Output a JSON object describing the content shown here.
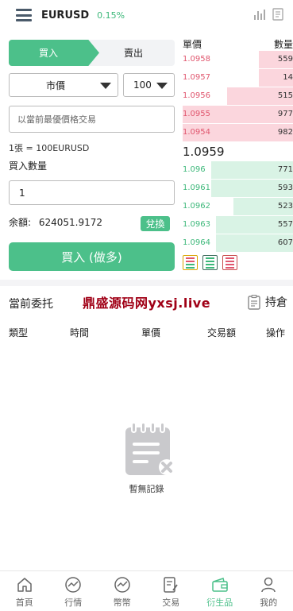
{
  "header": {
    "symbol": "EURUSD",
    "change": "0.15%"
  },
  "trade": {
    "buy_tab": "買入",
    "sell_tab": "賣出",
    "order_type": "市價",
    "amount": "100",
    "price_placeholder": "以當前最優價格交易",
    "lot_info": "1張 = 100EURUSD",
    "qty_label": "買入數量",
    "qty_value": "1",
    "balance_label": "余額:",
    "balance_value": "624051.9172",
    "exchange_label": "兌換",
    "buy_button": "買入 (做多)"
  },
  "orderbook": {
    "price_header": "單價",
    "qty_header": "數量",
    "asks": [
      {
        "price": "1.0958",
        "qty": "559",
        "depth": 0.31
      },
      {
        "price": "1.0957",
        "qty": "14",
        "depth": 0.31
      },
      {
        "price": "1.0956",
        "qty": "515",
        "depth": 0.6
      },
      {
        "price": "1.0955",
        "qty": "977",
        "depth": 1.0
      },
      {
        "price": "1.0954",
        "qty": "982",
        "depth": 1.0
      }
    ],
    "mid_price": "1.0959",
    "bids": [
      {
        "price": "1.096",
        "qty": "771",
        "depth": 0.74
      },
      {
        "price": "1.0961",
        "qty": "593",
        "depth": 0.74
      },
      {
        "price": "1.0962",
        "qty": "523",
        "depth": 0.54
      },
      {
        "price": "1.0963",
        "qty": "557",
        "depth": 0.7
      },
      {
        "price": "1.0964",
        "qty": "607",
        "depth": 0.7
      }
    ]
  },
  "orders": {
    "title": "當前委托",
    "watermark": "鼎盛源码网yxsj.live",
    "hold_label": "持倉",
    "columns": [
      "類型",
      "時間",
      "單價",
      "交易額",
      "操作"
    ],
    "empty_text": "暫無記錄"
  },
  "nav": [
    {
      "label": "首頁",
      "icon": "home-icon"
    },
    {
      "label": "行情",
      "icon": "market-icon"
    },
    {
      "label": "幣幣",
      "icon": "coin-icon"
    },
    {
      "label": "交易",
      "icon": "trade-icon"
    },
    {
      "label": "衍生品",
      "icon": "wallet-icon",
      "active": true
    },
    {
      "label": "我的",
      "icon": "profile-icon"
    }
  ],
  "colors": {
    "accent": "#4cc08a",
    "ask": "#e0566e",
    "bid": "#3db87a",
    "watermark": "#a00016"
  }
}
